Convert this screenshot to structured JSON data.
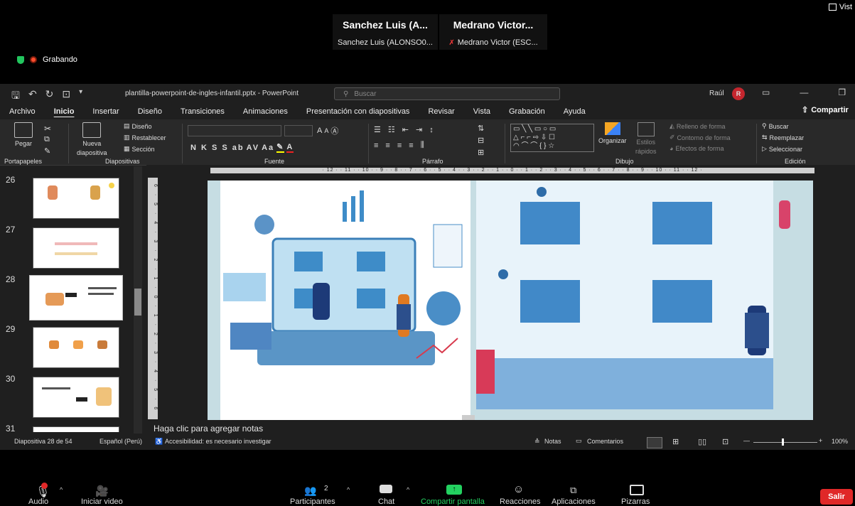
{
  "zoom": {
    "view_label": "Vist",
    "participants": [
      {
        "tile_name": "Sanchez Luis (A...",
        "label": "Sanchez Luis (ALONSO0..."
      },
      {
        "tile_name": "Medrano Victor...",
        "label": "Medrano Victor (ESC..."
      }
    ],
    "recording_label": "Grabando",
    "toolbar": {
      "audio": "Audio",
      "video": "Iniciar video",
      "participants": "Participantes",
      "participants_count": "2",
      "chat": "Chat",
      "share": "Compartir pantalla",
      "reactions": "Reacciones",
      "apps": "Aplicaciones",
      "whiteboards": "Pizarras",
      "leave": "Salir"
    },
    "colors": {
      "share_green": "#23d160",
      "leave_red": "#e02828",
      "record": "#ff4d2e"
    }
  },
  "ppt": {
    "filename": "plantilla-powerpoint-de-ingles-infantil.pptx  -  PowerPoint",
    "search_placeholder": "Buscar",
    "user": "Raúl",
    "user_initial": "R",
    "tabs": [
      "Archivo",
      "Inicio",
      "Insertar",
      "Diseño",
      "Transiciones",
      "Animaciones",
      "Presentación con diapositivas",
      "Revisar",
      "Vista",
      "Grabación",
      "Ayuda"
    ],
    "share_label": "Compartir",
    "ribbon": {
      "paste": "Pegar",
      "new_slide": "Nueva",
      "new_slide2": "diapositiva",
      "design": "Diseño",
      "reset": "Restablecer",
      "section": "Sección",
      "groups": [
        "Portapapeles",
        "Diapositivas",
        "Fuente",
        "Párrafo",
        "Dibujo",
        "Edición"
      ],
      "organize": "Organizar",
      "quick_styles": "Estilos",
      "quick_styles2": "rápidos",
      "fill": "Relleno de forma",
      "outline": "Contorno de forma",
      "effects": "Efectos de forma",
      "find": "Buscar",
      "replace": "Reemplazar",
      "select": "Seleccionar",
      "font_buttons": "N  K  S  S  ab",
      "font_size_up": "A",
      "font_size_down": "A",
      "change_case": "Aa"
    },
    "ruler_text": "· 12 · · 11 · · 10 · · 9 · · 8 · · 7 · · 6 · · 5 · · 4 · · 3 · · 2 · · 1 · · 0 · · 1 · · 2 · · 3 · · 4 · · 5 · · 6 · · 7 · · 8 · · 9 · · 10 · · 11 · · 12 ·",
    "vruler_text": "6 · 5 · 4 · 3 · 2 · 1 · 0 · 1 · 2 · 3 · 4 · 5 · 6",
    "slides": [
      "26",
      "27",
      "28",
      "29",
      "30",
      "31"
    ],
    "selected_slide": "28",
    "notes_placeholder": "Haga clic para agregar notas",
    "status": {
      "slide_info": "Diapositiva 28 de 54",
      "language": "Español (Perú)",
      "accessibility": "Accesibilidad: es necesario investigar",
      "notes": "Notas",
      "comments": "Comentarios",
      "zoom": "100%"
    }
  }
}
